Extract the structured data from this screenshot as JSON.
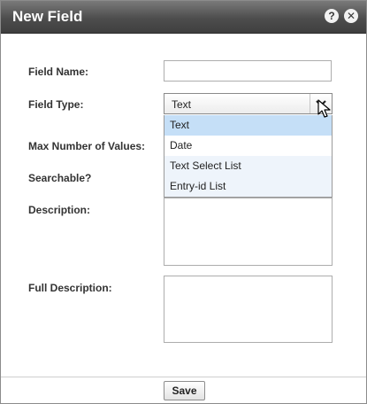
{
  "dialog": {
    "title": "New Field",
    "help_icon": "help-icon",
    "close_icon": "close-icon"
  },
  "form": {
    "field_name_label": "Field Name:",
    "field_name_value": "",
    "field_type_label": "Field Type:",
    "field_type_value": "Text",
    "field_type_options": [
      "Text",
      "Date",
      "Text Select List",
      "Entry-id List"
    ],
    "max_values_label": "Max Number of Values:",
    "searchable_label": "Searchable?",
    "description_label": "Description:",
    "description_value": "",
    "full_description_label": "Full Description:",
    "full_description_value": ""
  },
  "footer": {
    "save_label": "Save"
  },
  "colors": {
    "titlebar": "#4d4d4d",
    "selected_option": "#c5dff7",
    "alt_option": "#eef4fb"
  }
}
